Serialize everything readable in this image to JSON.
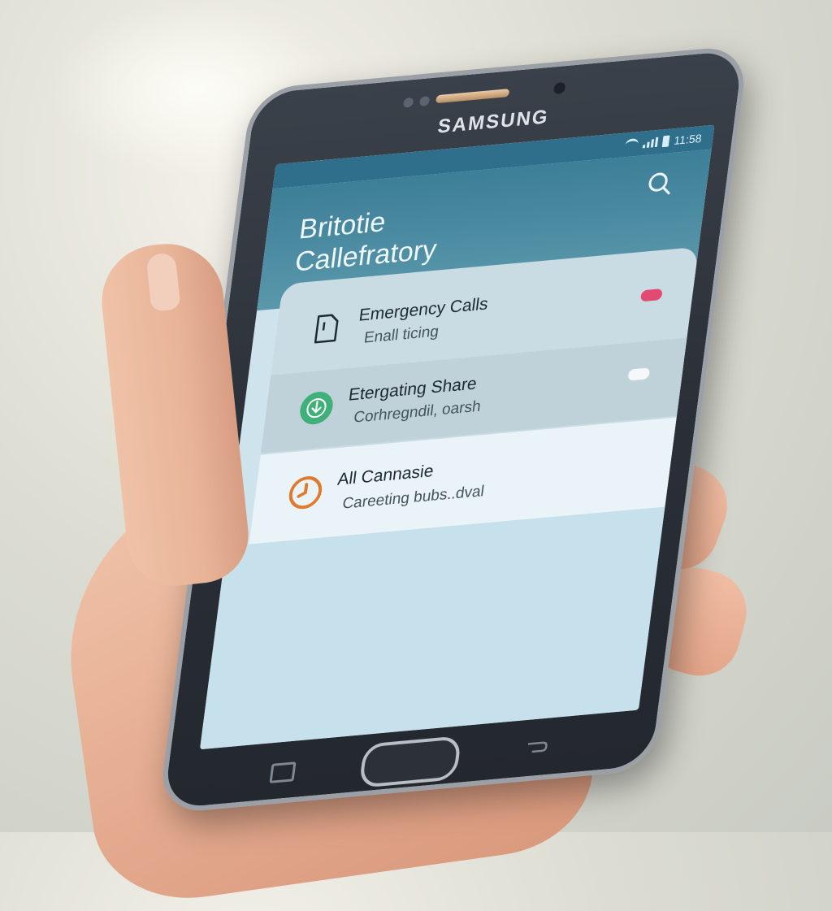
{
  "phone": {
    "brand": "SAMSUNG",
    "status_time": "11:58"
  },
  "app": {
    "title_line1": "Britotie",
    "title_line2": "Callefratory"
  },
  "list": [
    {
      "title": "Emergency Calls",
      "subtitle": "Enall ticing",
      "icon": "document-icon",
      "toggle_color": "#e24a73"
    },
    {
      "title": "Etergating Share",
      "subtitle": "Corhregndil, oarsh",
      "icon": "download-circle-icon",
      "toggle_color": "#f4f8fa"
    },
    {
      "title": "All Cannasie",
      "subtitle": "Careeting bubs..dval",
      "icon": "history-icon"
    }
  ],
  "colors": {
    "header": "#3d7f98",
    "accent_green": "#3fb07a",
    "accent_orange": "#e07a2e",
    "toggle_on": "#e24a73"
  }
}
